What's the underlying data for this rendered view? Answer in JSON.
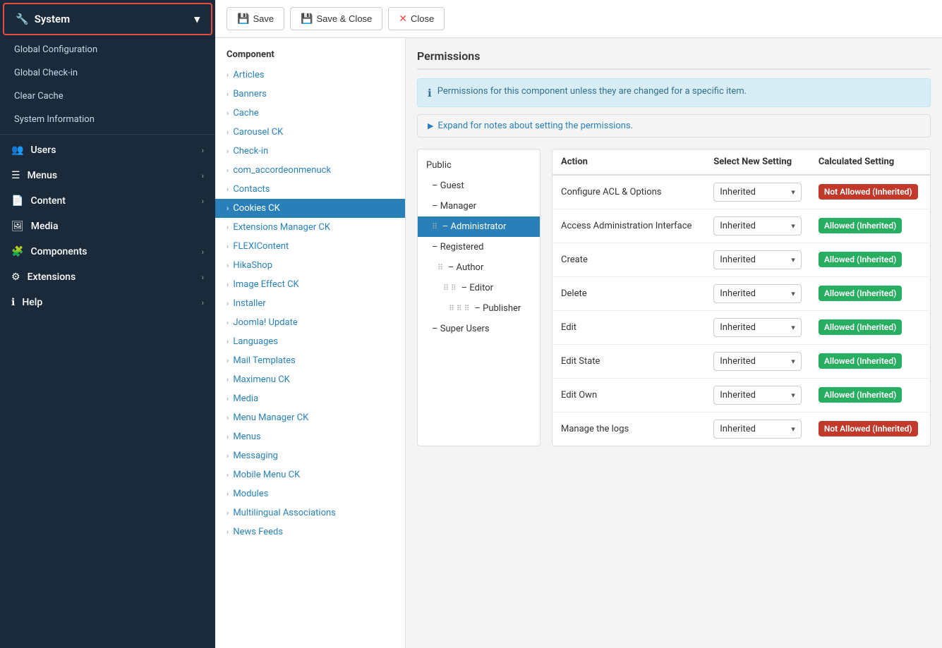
{
  "sidebar": {
    "system_label": "System",
    "menu_items": [
      {
        "id": "global-configuration",
        "label": "Global Configuration",
        "indent": 0
      },
      {
        "id": "global-checkin",
        "label": "Global Check-in",
        "indent": 0
      },
      {
        "id": "clear-cache",
        "label": "Clear Cache",
        "indent": 0
      },
      {
        "id": "system-information",
        "label": "System Information",
        "indent": 0
      }
    ],
    "nav_sections": [
      {
        "id": "users",
        "label": "Users",
        "icon": "👥"
      },
      {
        "id": "menus",
        "label": "Menus",
        "icon": "☰"
      },
      {
        "id": "content",
        "label": "Content",
        "icon": "📄"
      },
      {
        "id": "media",
        "label": "Media",
        "icon": "🖼"
      },
      {
        "id": "components",
        "label": "Components",
        "icon": "🧩"
      },
      {
        "id": "extensions",
        "label": "Extensions",
        "icon": "⚙"
      },
      {
        "id": "help",
        "label": "Help",
        "icon": "ℹ"
      }
    ]
  },
  "toolbar": {
    "save_label": "Save",
    "save_close_label": "Save & Close",
    "close_label": "Close"
  },
  "component_panel": {
    "header": "Component",
    "items": [
      {
        "id": "articles",
        "label": "Articles",
        "active": false
      },
      {
        "id": "banners",
        "label": "Banners",
        "active": false
      },
      {
        "id": "cache",
        "label": "Cache",
        "active": false
      },
      {
        "id": "carousel-ck",
        "label": "Carousel CK",
        "active": false
      },
      {
        "id": "check-in",
        "label": "Check-in",
        "active": false
      },
      {
        "id": "com-accordeonmenuck",
        "label": "com_accordeonmenuck",
        "active": false
      },
      {
        "id": "contacts",
        "label": "Contacts",
        "active": false
      },
      {
        "id": "cookies-ck",
        "label": "Cookies CK",
        "active": true
      },
      {
        "id": "extensions-manager-ck",
        "label": "Extensions Manager CK",
        "active": false
      },
      {
        "id": "flexicontent",
        "label": "FLEXIContent",
        "active": false
      },
      {
        "id": "hikashop",
        "label": "HikaShop",
        "active": false
      },
      {
        "id": "image-effect-ck",
        "label": "Image Effect CK",
        "active": false
      },
      {
        "id": "installer",
        "label": "Installer",
        "active": false
      },
      {
        "id": "joomla-update",
        "label": "Joomla! Update",
        "active": false
      },
      {
        "id": "languages",
        "label": "Languages",
        "active": false
      },
      {
        "id": "mail-templates",
        "label": "Mail Templates",
        "active": false
      },
      {
        "id": "maximenu-ck",
        "label": "Maximenu CK",
        "active": false
      },
      {
        "id": "media",
        "label": "Media",
        "active": false
      },
      {
        "id": "menu-manager-ck",
        "label": "Menu Manager CK",
        "active": false
      },
      {
        "id": "menus",
        "label": "Menus",
        "active": false
      },
      {
        "id": "messaging",
        "label": "Messaging",
        "active": false
      },
      {
        "id": "mobile-menu-ck",
        "label": "Mobile Menu CK",
        "active": false
      },
      {
        "id": "modules",
        "label": "Modules",
        "active": false
      },
      {
        "id": "multilingual-associations",
        "label": "Multilingual Associations",
        "active": false
      },
      {
        "id": "news-feeds",
        "label": "News Feeds",
        "active": false
      }
    ]
  },
  "permissions": {
    "title": "Permissions",
    "info_text": "Permissions for this component unless they are changed for a specific item.",
    "expand_text": "Expand for notes about setting the permissions.",
    "user_groups": [
      {
        "id": "public",
        "label": "Public",
        "indent": 0,
        "active": false
      },
      {
        "id": "guest",
        "label": "– Guest",
        "indent": 1,
        "active": false
      },
      {
        "id": "manager",
        "label": "– Manager",
        "indent": 1,
        "active": false
      },
      {
        "id": "administrator",
        "label": "– Administrator",
        "indent": 1,
        "active": true
      },
      {
        "id": "registered",
        "label": "– Registered",
        "indent": 1,
        "active": false
      },
      {
        "id": "author",
        "label": "– Author",
        "indent": 2,
        "active": false
      },
      {
        "id": "editor",
        "label": "– Editor",
        "indent": 3,
        "active": false
      },
      {
        "id": "publisher",
        "label": "– Publisher",
        "indent": 4,
        "active": false
      },
      {
        "id": "super-users",
        "label": "– Super Users",
        "indent": 1,
        "active": false
      }
    ],
    "table": {
      "col_action": "Action",
      "col_select": "Select New Setting",
      "col_calculated": "Calculated Setting",
      "rows": [
        {
          "id": "configure-acl",
          "action": "Configure ACL & Options",
          "select_value": "Inherited",
          "calculated": "Not Allowed (Inherited)",
          "calc_type": "not-allowed"
        },
        {
          "id": "access-admin",
          "action": "Access Administration Interface",
          "select_value": "Inherited",
          "calculated": "Allowed (Inherited)",
          "calc_type": "allowed"
        },
        {
          "id": "create",
          "action": "Create",
          "select_value": "Inherited",
          "calculated": "Allowed (Inherited)",
          "calc_type": "allowed"
        },
        {
          "id": "delete",
          "action": "Delete",
          "select_value": "Inherited",
          "calculated": "Allowed (Inherited)",
          "calc_type": "allowed"
        },
        {
          "id": "edit",
          "action": "Edit",
          "select_value": "Inherited",
          "calculated": "Allowed (Inherited)",
          "calc_type": "allowed"
        },
        {
          "id": "edit-state",
          "action": "Edit State",
          "select_value": "Inherited",
          "calculated": "Allowed (Inherited)",
          "calc_type": "allowed"
        },
        {
          "id": "edit-own",
          "action": "Edit Own",
          "select_value": "Inherited",
          "calculated": "Allowed (Inherited)",
          "calc_type": "allowed"
        },
        {
          "id": "manage-logs",
          "action": "Manage the logs",
          "select_value": "Inherited",
          "calculated": "Not Allowed (Inherited)",
          "calc_type": "not-allowed"
        }
      ]
    }
  }
}
